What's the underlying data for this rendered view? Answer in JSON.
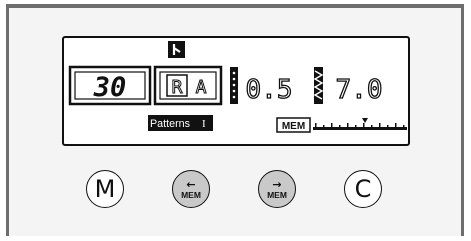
{
  "display": {
    "stitch_number": "30",
    "pattern_chars": [
      "R",
      "A"
    ],
    "patterns_label": "Patterns",
    "patterns_bank": "I",
    "length_value": "0.5",
    "width_value": "7.0",
    "mem_label": "MEM",
    "mode_icon": "needle-position-icon",
    "length_icon": "stitch-length-icon",
    "width_icon": "zigzag-width-icon"
  },
  "buttons": {
    "m_label": "M",
    "mem_back_arrow": "←",
    "mem_back_label": "MEM",
    "mem_forward_arrow": "→",
    "mem_forward_label": "MEM",
    "c_label": "C"
  },
  "colors": {
    "frame": "#6e6e6e",
    "lcd_ink": "#111111",
    "button_gray": "#c9c9c9"
  }
}
